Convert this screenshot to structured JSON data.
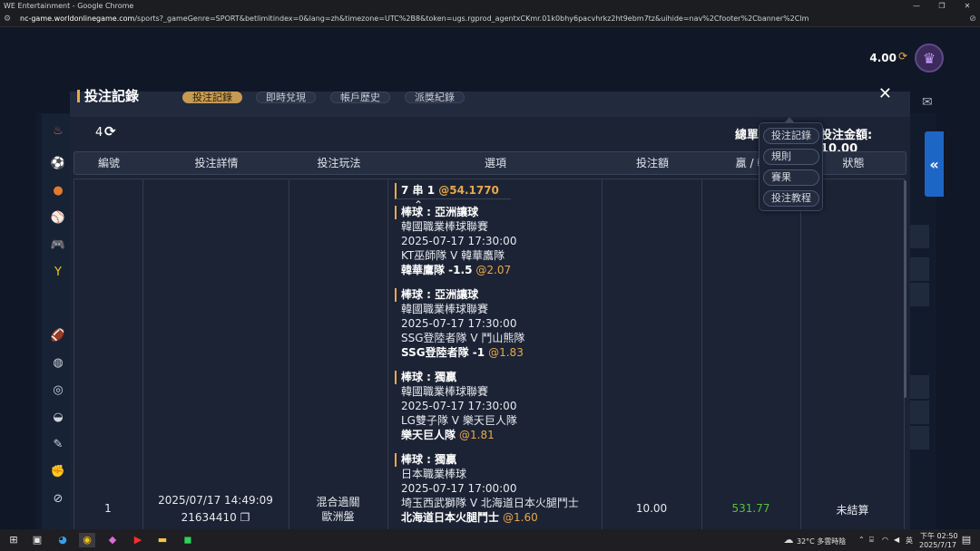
{
  "window": {
    "title": "WE Entertainment - Google Chrome",
    "minimize": "—",
    "restore": "❐",
    "close": "✕"
  },
  "address": {
    "domain": "nc-game.worldonlinegame.com",
    "path": "/sports?_gameGenre=SPORT&betlimitindex=0&lang=zh&timezone=UTC%2B8&token=ugs.rgprod_agentxCKmr.01k0bhy6pacvhrkz2ht9ebm7tz&uihide=nav%2Cfooter%2Cbanner%2Clm"
  },
  "header": {
    "balance": "4.00"
  },
  "modal": {
    "title": "投注記錄",
    "tabs": [
      "投注記錄",
      "即時兌現",
      "帳戶歷史",
      "派獎紀錄"
    ],
    "count": "4",
    "summary_label": "總單",
    "summary_amount_label": "投注金額: 10.00",
    "columns": [
      "編號",
      "投注詳情",
      "投注玩法",
      "選項",
      "投注額",
      "贏 / 輸",
      "狀態"
    ]
  },
  "row": {
    "id": "1",
    "datetime": "2025/07/17 14:49:09",
    "ticket": "21634410",
    "play_type_line1": "混合過關",
    "play_type_line2": "歐洲盤",
    "amount": "10.00",
    "win_loss": "531.77",
    "status": "未結算",
    "parlay": {
      "title": "7 串 1",
      "odds": "@54.1770"
    },
    "legs": [
      {
        "market": "棒球 : 亞洲讓球",
        "league": "韓國職業棒球聯賽",
        "time": "2025-07-17 17:30:00",
        "match": "KT巫師隊 V 韓華鷹隊",
        "pick": "韓華鷹隊 -1.5",
        "odds": "@2.07"
      },
      {
        "market": "棒球 : 亞洲讓球",
        "league": "韓國職業棒球聯賽",
        "time": "2025-07-17 17:30:00",
        "match": "SSG登陸者隊 V 鬥山熊隊",
        "pick": "SSG登陸者隊 -1",
        "odds": "@1.83"
      },
      {
        "market": "棒球 : 獨贏",
        "league": "韓國職業棒球聯賽",
        "time": "2025-07-17 17:30:00",
        "match": "LG雙子隊 V 樂天巨人隊",
        "pick": "樂天巨人隊",
        "odds": "@1.81"
      },
      {
        "market": "棒球 : 獨贏",
        "league": "日本職業棒球",
        "time": "2025-07-17 17:00:00",
        "match": "埼玉西武獅隊 V 北海道日本火腿鬥士",
        "pick": "北海道日本火腿鬥士",
        "odds": "@1.60"
      }
    ]
  },
  "popup": {
    "items": [
      "投注記錄",
      "規則",
      "賽果",
      "投注教程"
    ]
  },
  "taskbar": {
    "weather": "32°C 多雲時陰",
    "ime": "英",
    "time": "下午 02:50",
    "date": "2025/7/17"
  },
  "colors": {
    "accent": "#e7a94a",
    "win": "#55c23b",
    "collapse_button": "#1e66c6"
  }
}
